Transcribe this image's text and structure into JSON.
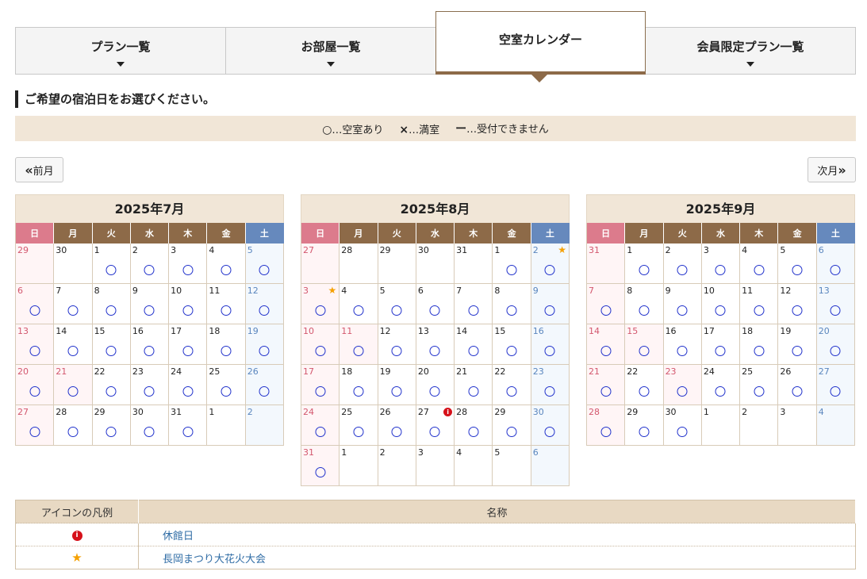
{
  "tabs": [
    {
      "label": "プラン一覧",
      "active": false
    },
    {
      "label": "お部屋一覧",
      "active": false
    },
    {
      "label": "空室カレンダー",
      "active": true
    },
    {
      "label": "会員限定プラン一覧",
      "active": false
    }
  ],
  "heading": "ご希望の宿泊日をお選びください。",
  "legend": {
    "available_symbol": "○",
    "available_text": "…空室あり",
    "full_symbol": "×",
    "full_text": "…満室",
    "closed_symbol": "ー",
    "closed_text": "…受付できません"
  },
  "nav": {
    "prev_label": "前月",
    "next_label": "次月",
    "prev_arrow": "«",
    "next_arrow": "»"
  },
  "weekdays": [
    "日",
    "月",
    "火",
    "水",
    "木",
    "金",
    "土"
  ],
  "calendars": [
    {
      "title": "2025年7月",
      "weeks": [
        [
          {
            "d": "29",
            "o": true
          },
          {
            "d": "30",
            "o": true
          },
          {
            "d": "1",
            "a": true
          },
          {
            "d": "2",
            "a": true
          },
          {
            "d": "3",
            "a": true
          },
          {
            "d": "4",
            "a": true
          },
          {
            "d": "5",
            "a": true
          }
        ],
        [
          {
            "d": "6",
            "a": true
          },
          {
            "d": "7",
            "a": true
          },
          {
            "d": "8",
            "a": true
          },
          {
            "d": "9",
            "a": true
          },
          {
            "d": "10",
            "a": true
          },
          {
            "d": "11",
            "a": true
          },
          {
            "d": "12",
            "a": true
          }
        ],
        [
          {
            "d": "13",
            "a": true
          },
          {
            "d": "14",
            "a": true
          },
          {
            "d": "15",
            "a": true
          },
          {
            "d": "16",
            "a": true
          },
          {
            "d": "17",
            "a": true
          },
          {
            "d": "18",
            "a": true
          },
          {
            "d": "19",
            "a": true
          }
        ],
        [
          {
            "d": "20",
            "a": true
          },
          {
            "d": "21",
            "a": true,
            "hol": true
          },
          {
            "d": "22",
            "a": true
          },
          {
            "d": "23",
            "a": true
          },
          {
            "d": "24",
            "a": true
          },
          {
            "d": "25",
            "a": true
          },
          {
            "d": "26",
            "a": true
          }
        ],
        [
          {
            "d": "27",
            "a": true
          },
          {
            "d": "28",
            "a": true
          },
          {
            "d": "29",
            "a": true
          },
          {
            "d": "30",
            "a": true
          },
          {
            "d": "31",
            "a": true
          },
          {
            "d": "1",
            "o": true
          },
          {
            "d": "2",
            "o": true
          }
        ]
      ]
    },
    {
      "title": "2025年8月",
      "weeks": [
        [
          {
            "d": "27",
            "o": true
          },
          {
            "d": "28",
            "o": true
          },
          {
            "d": "29",
            "o": true
          },
          {
            "d": "30",
            "o": true
          },
          {
            "d": "31",
            "o": true
          },
          {
            "d": "1",
            "a": true
          },
          {
            "d": "2",
            "a": true,
            "star": true
          }
        ],
        [
          {
            "d": "3",
            "a": true,
            "star": true
          },
          {
            "d": "4",
            "a": true
          },
          {
            "d": "5",
            "a": true
          },
          {
            "d": "6",
            "a": true
          },
          {
            "d": "7",
            "a": true
          },
          {
            "d": "8",
            "a": true
          },
          {
            "d": "9",
            "a": true
          }
        ],
        [
          {
            "d": "10",
            "a": true
          },
          {
            "d": "11",
            "a": true,
            "hol": true
          },
          {
            "d": "12",
            "a": true
          },
          {
            "d": "13",
            "a": true
          },
          {
            "d": "14",
            "a": true
          },
          {
            "d": "15",
            "a": true
          },
          {
            "d": "16",
            "a": true
          }
        ],
        [
          {
            "d": "17",
            "a": true
          },
          {
            "d": "18",
            "a": true
          },
          {
            "d": "19",
            "a": true
          },
          {
            "d": "20",
            "a": true
          },
          {
            "d": "21",
            "a": true
          },
          {
            "d": "22",
            "a": true
          },
          {
            "d": "23",
            "a": true
          }
        ],
        [
          {
            "d": "24",
            "a": true
          },
          {
            "d": "25",
            "a": true
          },
          {
            "d": "26",
            "a": true
          },
          {
            "d": "27",
            "a": true,
            "info": true
          },
          {
            "d": "28",
            "a": true
          },
          {
            "d": "29",
            "a": true
          },
          {
            "d": "30",
            "a": true
          }
        ],
        [
          {
            "d": "31",
            "a": true
          },
          {
            "d": "1",
            "o": true
          },
          {
            "d": "2",
            "o": true
          },
          {
            "d": "3",
            "o": true
          },
          {
            "d": "4",
            "o": true
          },
          {
            "d": "5",
            "o": true
          },
          {
            "d": "6",
            "o": true
          }
        ]
      ]
    },
    {
      "title": "2025年9月",
      "weeks": [
        [
          {
            "d": "31",
            "o": true
          },
          {
            "d": "1",
            "a": true
          },
          {
            "d": "2",
            "a": true
          },
          {
            "d": "3",
            "a": true
          },
          {
            "d": "4",
            "a": true
          },
          {
            "d": "5",
            "a": true
          },
          {
            "d": "6",
            "a": true
          }
        ],
        [
          {
            "d": "7",
            "a": true
          },
          {
            "d": "8",
            "a": true
          },
          {
            "d": "9",
            "a": true
          },
          {
            "d": "10",
            "a": true
          },
          {
            "d": "11",
            "a": true
          },
          {
            "d": "12",
            "a": true
          },
          {
            "d": "13",
            "a": true
          }
        ],
        [
          {
            "d": "14",
            "a": true
          },
          {
            "d": "15",
            "a": true,
            "hol": true
          },
          {
            "d": "16",
            "a": true
          },
          {
            "d": "17",
            "a": true
          },
          {
            "d": "18",
            "a": true
          },
          {
            "d": "19",
            "a": true
          },
          {
            "d": "20",
            "a": true
          }
        ],
        [
          {
            "d": "21",
            "a": true
          },
          {
            "d": "22",
            "a": true
          },
          {
            "d": "23",
            "a": true,
            "hol": true
          },
          {
            "d": "24",
            "a": true
          },
          {
            "d": "25",
            "a": true
          },
          {
            "d": "26",
            "a": true
          },
          {
            "d": "27",
            "a": true
          }
        ],
        [
          {
            "d": "28",
            "a": true
          },
          {
            "d": "29",
            "a": true
          },
          {
            "d": "30",
            "a": true
          },
          {
            "d": "1",
            "o": true
          },
          {
            "d": "2",
            "o": true
          },
          {
            "d": "3",
            "o": true
          },
          {
            "d": "4",
            "o": true
          }
        ]
      ]
    }
  ],
  "icon_legend": {
    "header_icon": "アイコンの凡例",
    "header_name": "名称",
    "rows": [
      {
        "icon": "info-icon",
        "name": "休館日"
      },
      {
        "icon": "star-icon",
        "name": "長岡まつり大花火大会"
      }
    ]
  },
  "colors": {
    "accent_brown": "#8d6a48",
    "sunday": "#dc7b8c",
    "saturday": "#6689bd",
    "available_circle": "#2233cc",
    "star": "#f5a000",
    "info": "#d6111a"
  }
}
